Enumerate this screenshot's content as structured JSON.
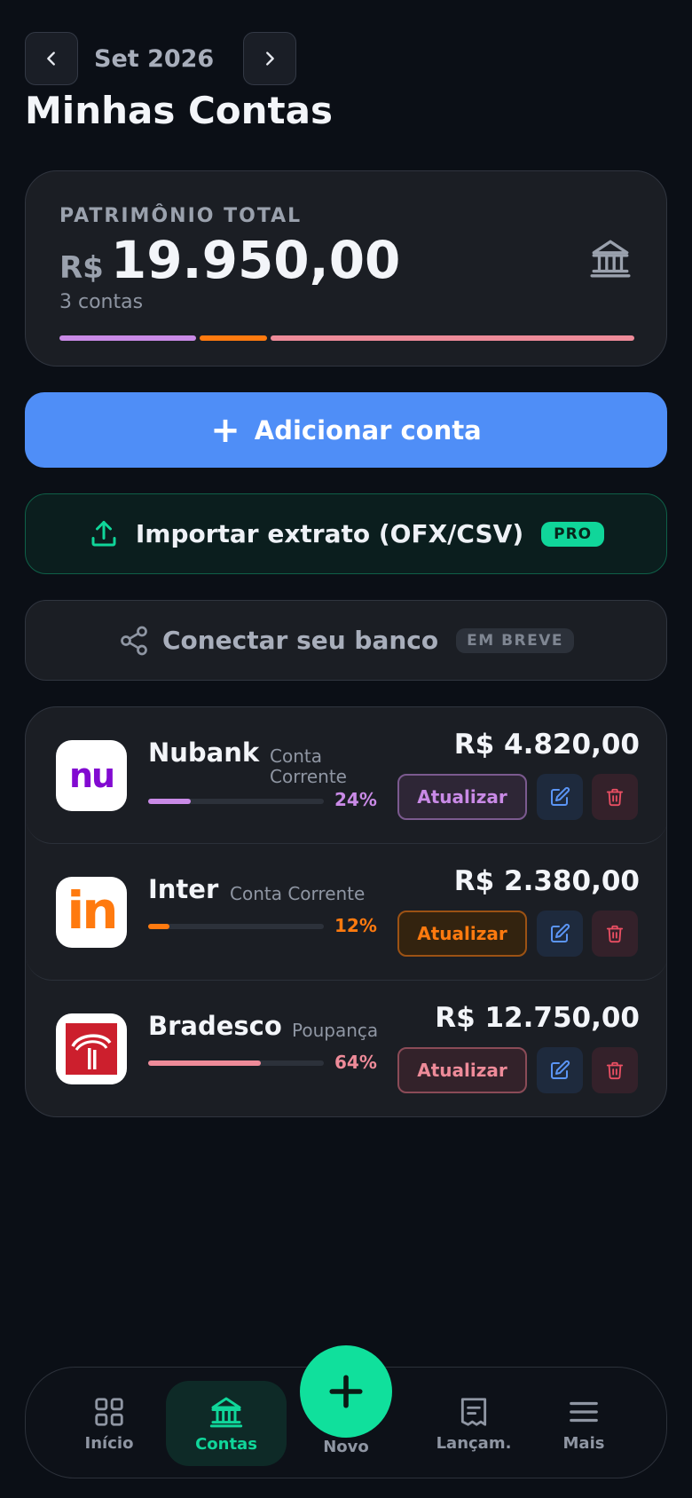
{
  "header": {
    "month": "Set 2026",
    "title": "Minhas Contas"
  },
  "summary": {
    "label": "PATRIMÔNIO TOTAL",
    "currency": "R$",
    "total": "19.950,00",
    "count": "3 contas"
  },
  "actions": {
    "add_label": "Adicionar conta",
    "import_label": "Importar extrato (OFX/CSV)",
    "import_badge": "PRO",
    "connect_label": "Conectar seu banco",
    "connect_badge": "EM BREVE"
  },
  "accounts": [
    {
      "name": "Nubank",
      "type": "Conta Corrente",
      "balance": "R$ 4.820,00",
      "percent": "24%",
      "share": 0.24,
      "color": "#c98ae6",
      "update_label": "Atualizar",
      "logo_text": "nu"
    },
    {
      "name": "Inter",
      "type": "Conta Corrente",
      "balance": "R$ 2.380,00",
      "percent": "12%",
      "share": 0.12,
      "color": "#ff7a0f",
      "update_label": "Atualizar",
      "logo_text": "in"
    },
    {
      "name": "Bradesco",
      "type": "Poupança",
      "balance": "R$ 12.750,00",
      "percent": "64%",
      "share": 0.64,
      "color": "#ee8b99",
      "update_label": "Atualizar",
      "logo_text": ""
    }
  ],
  "tabbar": {
    "items": [
      {
        "label": "Início",
        "icon": "grid-icon"
      },
      {
        "label": "Contas",
        "icon": "bank-icon"
      },
      {
        "label": "Novo",
        "icon": "plus-icon"
      },
      {
        "label": "Lançam.",
        "icon": "receipt-icon"
      },
      {
        "label": "Mais",
        "icon": "menu-icon"
      }
    ]
  },
  "colors": {
    "accent": "#10d69a",
    "primary_button": "#4f8ef7",
    "background": "#0b0f16"
  }
}
